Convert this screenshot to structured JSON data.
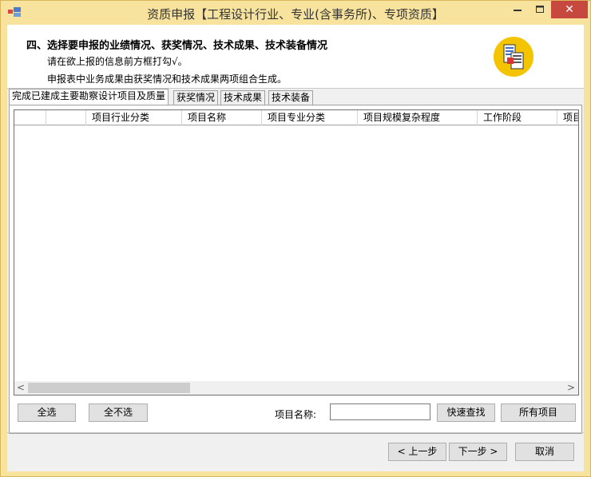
{
  "window": {
    "title": "资质申报【工程设计行业、专业(含事务所)、专项资质】",
    "close_glyph": "✕"
  },
  "header": {
    "title": "四、选择要申报的业绩情况、获奖情况、技术成果、技术装备情况",
    "line1": "请在欲上报的信息前方框打勾√。",
    "line2": "申报表中业务成果由获奖情况和技术成果两项组合生成。"
  },
  "tabs": [
    {
      "label": "完成已建成主要勘察设计项目及质量",
      "active": true
    },
    {
      "label": "获奖情况",
      "active": false
    },
    {
      "label": "技术成果",
      "active": false
    },
    {
      "label": "技术装备",
      "active": false
    }
  ],
  "grid": {
    "columns": [
      "",
      "",
      "项目行业分类",
      "项目名称",
      "项目专业分类",
      "项目规模复杂程度",
      "工作阶段",
      "项目"
    ]
  },
  "actions": {
    "select_all": "全选",
    "select_none": "全不选",
    "search_label": "项目名称:",
    "search_value": "",
    "quick_search": "快速查找",
    "all_items": "所有项目"
  },
  "footer": {
    "prev": "< 上一步",
    "next": "下一步 >",
    "cancel": "取消"
  },
  "colors": {
    "frame": "#f7e39d",
    "close": "#c7483e",
    "badge": "#f4c400"
  }
}
